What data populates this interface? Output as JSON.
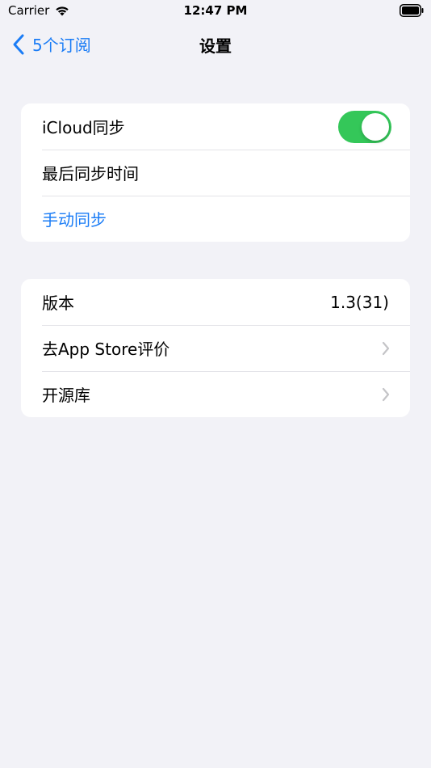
{
  "status_bar": {
    "carrier": "Carrier",
    "time": "12:47 PM"
  },
  "nav": {
    "back_label": "5个订阅",
    "title": "设置"
  },
  "sync_group": {
    "icloud_label": "iCloud同步",
    "icloud_enabled": true,
    "last_sync_label": "最后同步时间",
    "manual_sync_label": "手动同步"
  },
  "about_group": {
    "version_label": "版本",
    "version_value": "1.3(31)",
    "rate_label": "去App Store评价",
    "open_source_label": "开源库"
  },
  "colors": {
    "accent": "#1a7cf6",
    "toggle_on": "#34c759",
    "background": "#f2f2f7"
  }
}
